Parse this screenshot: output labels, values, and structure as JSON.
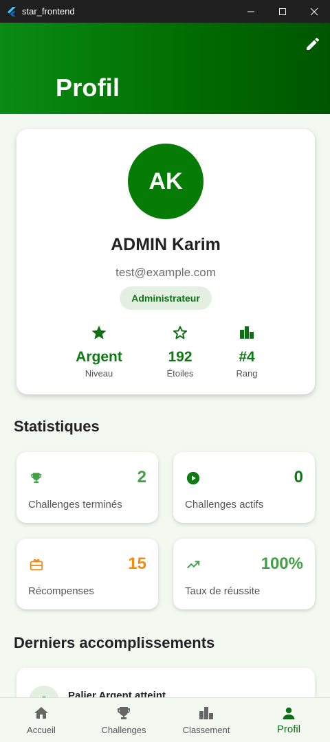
{
  "window": {
    "title": "star_frontend"
  },
  "header": {
    "title": "Profil"
  },
  "profile": {
    "initials": "AK",
    "name": "ADMIN Karim",
    "email": "test@example.com",
    "role": "Administrateur",
    "stats": [
      {
        "icon": "star-filled-icon",
        "value": "Argent",
        "label": "Niveau"
      },
      {
        "icon": "star-outline-icon",
        "value": "192",
        "label": "Étoiles"
      },
      {
        "icon": "bar-chart-icon",
        "value": "#4",
        "label": "Rang"
      }
    ]
  },
  "statistics": {
    "title": "Statistiques",
    "cards": [
      {
        "icon": "trophy-icon",
        "value": "2",
        "label": "Challenges terminés",
        "color": "#43a047"
      },
      {
        "icon": "play-circle-icon",
        "value": "0",
        "label": "Challenges actifs",
        "color": "#0d7a12"
      },
      {
        "icon": "gift-card-icon",
        "value": "15",
        "label": "Récompenses",
        "color": "#f28c0f"
      },
      {
        "icon": "trending-up-icon",
        "value": "100%",
        "label": "Taux de réussite",
        "color": "#43a047"
      }
    ]
  },
  "achievements": {
    "title": "Derniers accomplissements",
    "items": [
      {
        "icon": "medal-icon",
        "title": "Palier Argent atteint"
      }
    ]
  },
  "nav": {
    "items": [
      {
        "icon": "home-icon",
        "label": "Accueil",
        "active": false
      },
      {
        "icon": "trophy-icon",
        "label": "Challenges",
        "active": false
      },
      {
        "icon": "bar-chart-icon",
        "label": "Classement",
        "active": false
      },
      {
        "icon": "person-icon",
        "label": "Profil",
        "active": true
      }
    ]
  },
  "colors": {
    "primary": "#067c06",
    "accent_orange": "#f28c0f",
    "light_green": "#43a047",
    "background": "#f3f8f1"
  }
}
